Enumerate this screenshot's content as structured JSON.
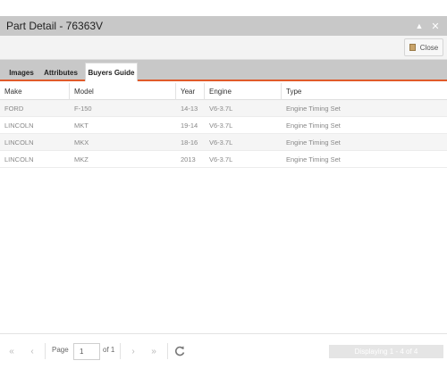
{
  "window": {
    "title": "Part Detail - 76363V"
  },
  "toolbar": {
    "close_label": "Close",
    "close_icon": "door-icon"
  },
  "tabs": [
    {
      "label": "Images",
      "active": false
    },
    {
      "label": "Attributes",
      "active": false
    },
    {
      "label": "Buyers Guide",
      "active": true
    }
  ],
  "grid": {
    "columns": [
      "Make",
      "Model",
      "Year",
      "Engine",
      "Type"
    ],
    "rows": [
      {
        "make": "FORD",
        "model": "F-150",
        "year": "14-13",
        "engine": "V6-3.7L",
        "type": "Engine Timing Set"
      },
      {
        "make": "LINCOLN",
        "model": "MKT",
        "year": "19-14",
        "engine": "V6-3.7L",
        "type": "Engine Timing Set"
      },
      {
        "make": "LINCOLN",
        "model": "MKX",
        "year": "18-16",
        "engine": "V6-3.7L",
        "type": "Engine Timing Set"
      },
      {
        "make": "LINCOLN",
        "model": "MKZ",
        "year": "2013",
        "engine": "V6-3.7L",
        "type": "Engine Timing Set"
      }
    ]
  },
  "pager": {
    "page_label": "Page",
    "page_value": "1",
    "of_label": "of 1",
    "display_text": "Displaying 1 - 4 of 4"
  },
  "colors": {
    "accent": "#e05a2a",
    "titlebar": "#c8c8c8"
  }
}
